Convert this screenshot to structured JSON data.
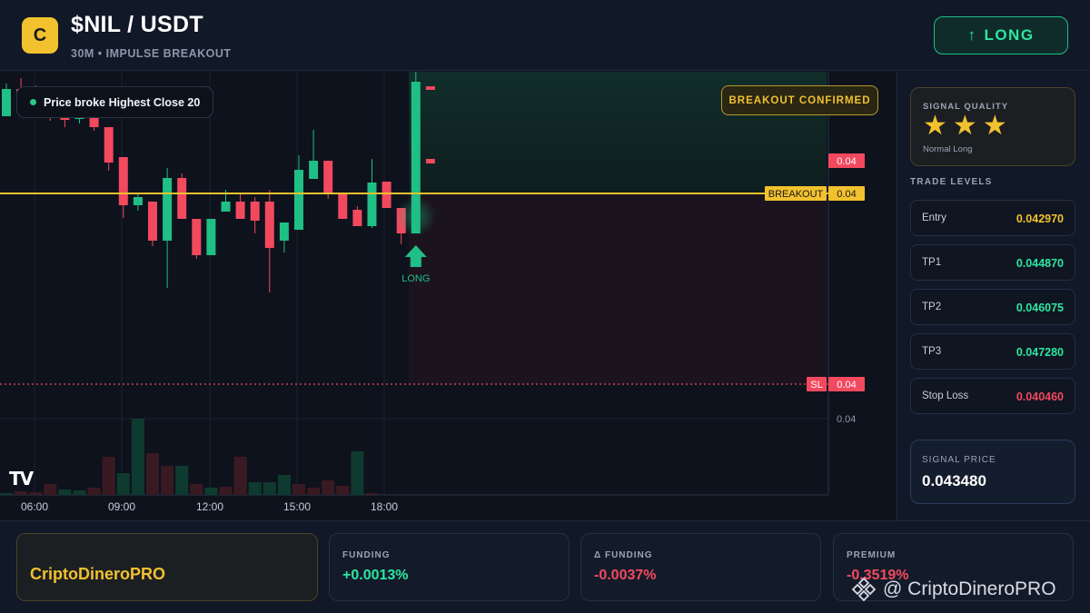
{
  "header": {
    "logo_letter": "C",
    "pair": "$NIL / USDT",
    "subtitle": "30M • IMPULSE BREAKOUT",
    "direction_button": "LONG",
    "direction_arrow": "↑"
  },
  "chart": {
    "note": "Price broke Highest Close 20",
    "status_badge": "BREAKOUT CONFIRMED",
    "signal_label": "LONG",
    "time_labels": [
      "06:00",
      "09:00",
      "12:00",
      "15:00",
      "18:00"
    ],
    "price_tag_current": "0.04",
    "breakout_label": "BREAKOUT",
    "breakout_value": "0.04",
    "sl_label": "SL",
    "sl_value": "0.04",
    "volume_scale_label": "0.04",
    "watermark_logo": "TV",
    "colors": {
      "up": "#1fbf85",
      "down": "#f2495f",
      "breakout": "#f2c12e"
    },
    "candles": [
      {
        "o": 85,
        "c": 115,
        "h": 121,
        "l": 85
      },
      {
        "o": 115,
        "c": 112,
        "h": 127,
        "l": 107
      },
      {
        "o": 115,
        "c": 102,
        "h": 119,
        "l": 93
      },
      {
        "o": 105,
        "c": 93,
        "h": 110,
        "l": 80
      },
      {
        "o": 92,
        "c": 81,
        "h": 97,
        "l": 73
      },
      {
        "o": 82,
        "c": 84,
        "h": 88,
        "l": 77
      },
      {
        "o": 84,
        "c": 73,
        "h": 93,
        "l": 69
      },
      {
        "o": 73,
        "c": 34,
        "h": 73,
        "l": 25
      },
      {
        "o": 40,
        "c": -13,
        "h": 40,
        "l": -27
      },
      {
        "o": -13,
        "c": -4,
        "h": -1,
        "l": -19
      },
      {
        "o": -9,
        "c": -52,
        "h": -9,
        "l": -58
      },
      {
        "o": -52,
        "c": 17,
        "h": 28,
        "l": -104
      },
      {
        "o": 17,
        "c": -28,
        "h": 22,
        "l": -28
      },
      {
        "o": -28,
        "c": -68,
        "h": -28,
        "l": -72
      },
      {
        "o": -68,
        "c": -28,
        "h": -28,
        "l": -68
      },
      {
        "o": -20,
        "c": -9,
        "h": 4,
        "l": -20
      },
      {
        "o": -9,
        "c": -28,
        "h": -1,
        "l": -28
      },
      {
        "o": -9,
        "c": -30,
        "h": -4,
        "l": -44
      },
      {
        "o": -9,
        "c": -60,
        "h": 4,
        "l": -109
      },
      {
        "o": -52,
        "c": -32,
        "h": -32,
        "l": -65
      },
      {
        "o": -40,
        "c": 26,
        "h": 42,
        "l": -40
      },
      {
        "o": 16,
        "c": 36,
        "h": 70,
        "l": 16
      },
      {
        "o": 36,
        "c": 0,
        "h": 36,
        "l": -6
      },
      {
        "o": 1,
        "c": -28,
        "h": 1,
        "l": -28
      },
      {
        "o": -18,
        "c": -36,
        "h": -14,
        "l": -36
      },
      {
        "o": -36,
        "c": 12,
        "h": 38,
        "l": -38
      },
      {
        "o": 13,
        "c": -16,
        "h": 13,
        "l": -16
      },
      {
        "o": -16,
        "c": -44,
        "h": -16,
        "l": -56
      },
      {
        "o": -44,
        "c": 123,
        "h": 139,
        "l": -44
      },
      {
        "o": 118,
        "c": 114,
        "h": 118,
        "l": 114
      }
    ],
    "volume": [
      {
        "v": 2,
        "up": true
      },
      {
        "v": 4,
        "up": false
      },
      {
        "v": 3,
        "up": false
      },
      {
        "v": 12,
        "up": false
      },
      {
        "v": 6,
        "up": true
      },
      {
        "v": 5,
        "up": true
      },
      {
        "v": 8,
        "up": false
      },
      {
        "v": 42,
        "up": false
      },
      {
        "v": 24,
        "up": true
      },
      {
        "v": 84,
        "up": true
      },
      {
        "v": 46,
        "up": false
      },
      {
        "v": 32,
        "up": false
      },
      {
        "v": 32,
        "up": true
      },
      {
        "v": 12,
        "up": false
      },
      {
        "v": 8,
        "up": true
      },
      {
        "v": 9,
        "up": false
      },
      {
        "v": 42,
        "up": false
      },
      {
        "v": 14,
        "up": true
      },
      {
        "v": 14,
        "up": true
      },
      {
        "v": 22,
        "up": true
      },
      {
        "v": 12,
        "up": false
      },
      {
        "v": 8,
        "up": false
      },
      {
        "v": 16,
        "up": false
      },
      {
        "v": 10,
        "up": false
      },
      {
        "v": 48,
        "up": true
      },
      {
        "v": 2,
        "up": false
      }
    ]
  },
  "signal": {
    "quality_label": "SIGNAL QUALITY",
    "stars": 3,
    "star_glyph": "★",
    "quality_type": "Normal Long",
    "levels_title": "TRADE LEVELS",
    "levels": [
      {
        "name": "Entry",
        "value": "0.042970",
        "color": "#f2c12e"
      },
      {
        "name": "TP1",
        "value": "0.044870",
        "color": "#2ee6a0"
      },
      {
        "name": "TP2",
        "value": "0.046075",
        "color": "#2ee6a0"
      },
      {
        "name": "TP3",
        "value": "0.047280",
        "color": "#2ee6a0"
      },
      {
        "name": "Stop Loss",
        "value": "0.040460",
        "color": "#f2495f"
      }
    ],
    "price_label": "SIGNAL PRICE",
    "price_value": "0.043480"
  },
  "footer": {
    "brand": "CriptoDineroPRO",
    "stats": [
      {
        "label": "FUNDING",
        "value": "+0.0013%",
        "color": "#2ee6a0"
      },
      {
        "label": "Δ FUNDING",
        "value": "-0.0037%",
        "color": "#f2495f"
      },
      {
        "label": "PREMIUM",
        "value": "-0.3519%",
        "color": "#f2495f"
      }
    ],
    "watermark": "@ CriptoDineroPRO"
  }
}
